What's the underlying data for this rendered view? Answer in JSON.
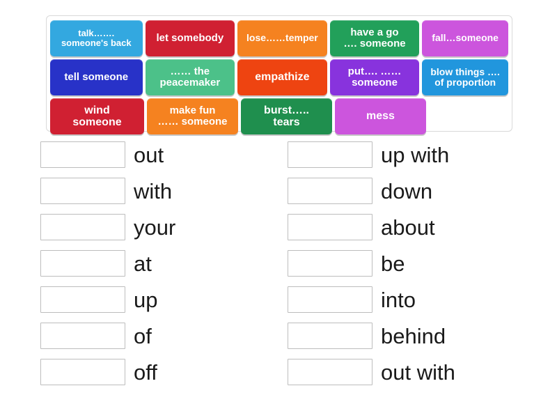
{
  "tile_bank": {
    "rows": [
      [
        {
          "text": "talk……. someone's back",
          "lines": [
            "talk…….",
            "someone's back"
          ],
          "color": "#33a8e0",
          "font_size": 13
        },
        {
          "text": "let somebody",
          "lines": [
            "let somebody"
          ],
          "color": "#d02032",
          "font_size": 15
        },
        {
          "text": "lose……temper",
          "lines": [
            "lose……temper"
          ],
          "color": "#f58220",
          "font_size": 14
        },
        {
          "text": "have a go …. someone",
          "lines": [
            "have a go",
            "…. someone"
          ],
          "color": "#22a05a",
          "font_size": 15
        },
        {
          "text": "fall…someone",
          "lines": [
            "fall…someone"
          ],
          "color": "#cc55dd",
          "font_size": 14
        }
      ],
      [
        {
          "text": "tell someone",
          "lines": [
            "tell someone"
          ],
          "color": "#2832c8",
          "font_size": 15
        },
        {
          "text": "…… the peacemaker",
          "lines": [
            "…… the",
            "peacemaker"
          ],
          "color": "#4cc189",
          "font_size": 15
        },
        {
          "text": "empathize",
          "lines": [
            "empathize"
          ],
          "color": "#ee4411",
          "font_size": 16
        },
        {
          "text": "put…. …… someone",
          "lines": [
            "put…. ……",
            "someone"
          ],
          "color": "#8833dd",
          "font_size": 15
        },
        {
          "text": "blow things …. of proportion",
          "lines": [
            "blow things ….",
            "of proportion"
          ],
          "color": "#2196dd",
          "font_size": 14
        }
      ],
      [
        {
          "text": "wind someone",
          "lines": [
            "wind",
            "someone"
          ],
          "color": "#d02032",
          "font_size": 16
        },
        {
          "text": "make fun …… someone",
          "lines": [
            "make fun",
            "…… someone"
          ],
          "color": "#f58220",
          "font_size": 15
        },
        {
          "text": "burst….. tears",
          "lines": [
            "burst…..",
            "tears"
          ],
          "color": "#1f8f4e",
          "font_size": 16
        },
        {
          "text": "mess",
          "lines": [
            "mess"
          ],
          "color": "#cc55dd",
          "font_size": 16
        }
      ]
    ]
  },
  "answers": {
    "left_column": [
      {
        "label": "out"
      },
      {
        "label": "with"
      },
      {
        "label": "your"
      },
      {
        "label": "at"
      },
      {
        "label": "up"
      },
      {
        "label": "of"
      },
      {
        "label": "off"
      }
    ],
    "right_column": [
      {
        "label": "up with"
      },
      {
        "label": "down"
      },
      {
        "label": "about"
      },
      {
        "label": "be"
      },
      {
        "label": "into"
      },
      {
        "label": "behind"
      },
      {
        "label": "out with"
      }
    ]
  },
  "colors": {
    "page_background": "#ffffff",
    "panel_border": "#d9d9d9",
    "slot_border": "#bdbdbd",
    "label_text": "#1a1a1a",
    "tile_text": "#ffffff"
  }
}
